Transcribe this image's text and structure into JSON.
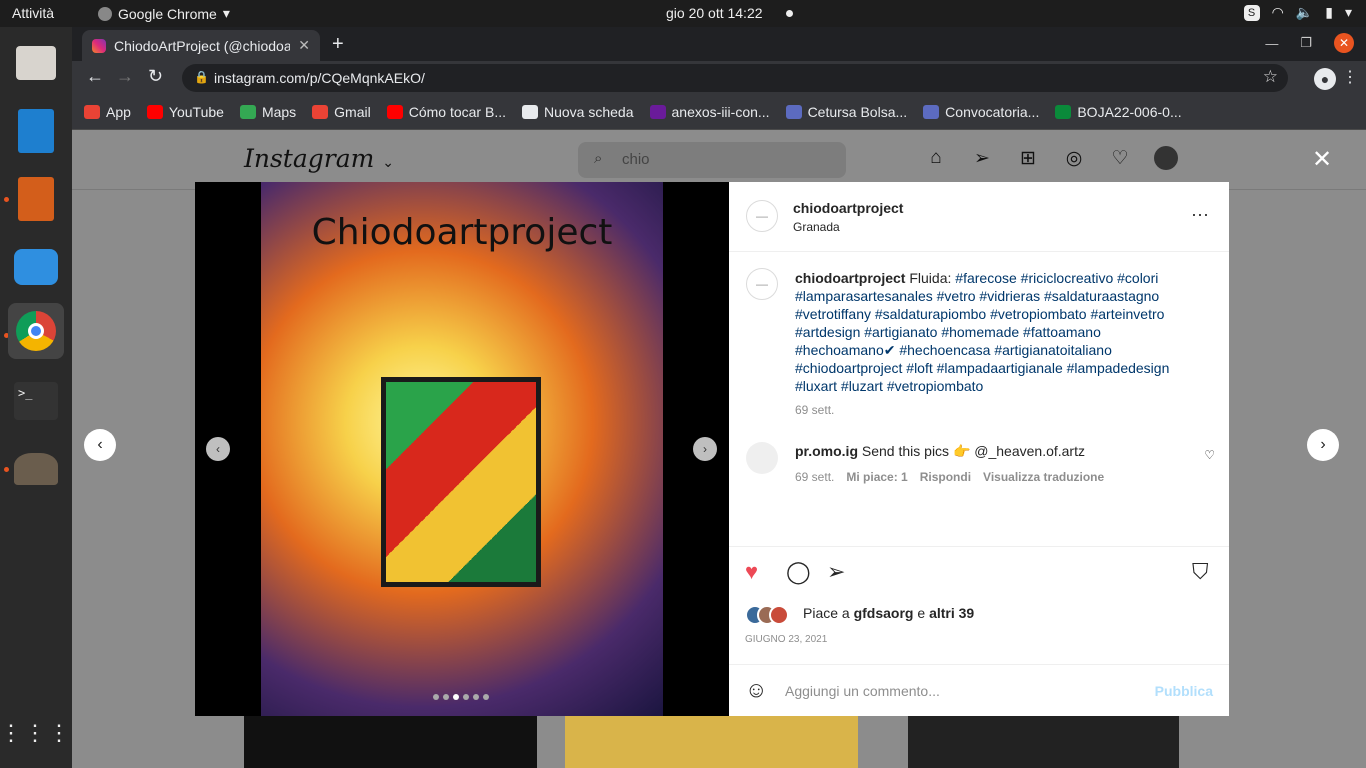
{
  "os": {
    "activities": "Attività",
    "app_name": "Google Chrome",
    "clock": "gio 20 ott  14:22"
  },
  "browser": {
    "tab_title": "ChiodoArtProject (@chiodoartproject)",
    "url": "instagram.com/p/CQeMqnkAEkO/",
    "bookmarks": [
      {
        "label": "App",
        "icon": "apps-grid-icon",
        "color": "#ea4335"
      },
      {
        "label": "YouTube",
        "icon": "youtube-icon",
        "color": "#ff0000"
      },
      {
        "label": "Maps",
        "icon": "maps-icon",
        "color": "#34a853"
      },
      {
        "label": "Gmail",
        "icon": "gmail-icon",
        "color": "#ea4335"
      },
      {
        "label": "Cómo tocar B...",
        "icon": "youtube-icon",
        "color": "#ff0000"
      },
      {
        "label": "Nuova scheda",
        "icon": "globe-icon",
        "color": "#e8eaed"
      },
      {
        "label": "anexos-iii-con...",
        "icon": "document-icon",
        "color": "#6a1b9a"
      },
      {
        "label": "Cetursa Bolsa...",
        "icon": "circle-icon",
        "color": "#5c6bc0"
      },
      {
        "label": "Convocatoria...",
        "icon": "circle-icon",
        "color": "#5c6bc0"
      },
      {
        "label": "BOJA22-006-0...",
        "icon": "boja-icon",
        "color": "#0a8a3a"
      }
    ]
  },
  "instagram": {
    "logo": "Instagram",
    "search_value": "chio",
    "post": {
      "image_caption": "Chiodoartproject",
      "carousel_dots": 6,
      "carousel_active": 2,
      "author": "chiodoartproject",
      "location": "Granada",
      "caption_user": "chiodoartproject",
      "caption_text": "Fluida:",
      "caption_tags": "#farecose #riciclocreativo #colori #lamparasartesanales #vetro #vidrieras #saldaturaastagno #vetrotiffany #saldaturapiombo #vetropiombato #arteinvetro #artdesign #artigianato #homemade #fattoamano #hechoamano✔ #hechoencasa #artigianatoitaliano #chiodoartproject #loft #lampadaartigianale #lampadedesign #luxart #luzart #vetropiombato",
      "caption_age": "69 sett.",
      "comment": {
        "user": "pr.omo.ig",
        "text": "Send this pics 👉 @_heaven.of.artz",
        "age": "69 sett.",
        "likes": "Mi piace: 1",
        "reply": "Rispondi",
        "translate": "Visualizza traduzione"
      },
      "likes_prefix": "Piace a",
      "likes_user": "gfdsaorg",
      "likes_mid": "e",
      "likes_rest": "altri 39",
      "date": "GIUGNO 23, 2021",
      "comment_placeholder": "Aggiungi un commento...",
      "publish": "Pubblica"
    }
  },
  "colors": {
    "heart": "#ed4956",
    "publish": "#b2dffc",
    "link": "#00376b",
    "accent_close": "#e95420"
  }
}
